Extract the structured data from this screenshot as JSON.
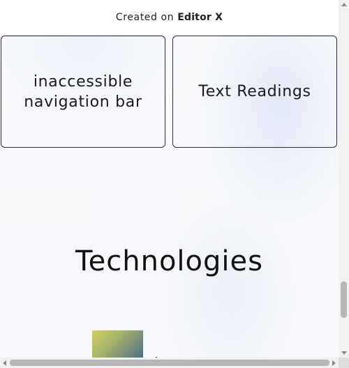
{
  "banner": {
    "prefix": "Created on",
    "brand": "Editor X"
  },
  "cards": [
    {
      "label": "inaccessible navigation bar"
    },
    {
      "label": "Text Readings"
    }
  ],
  "section": {
    "heading": "Technologies"
  },
  "colors": {
    "page_background": "#f7f9fc",
    "card_border": "#2a2a33",
    "text": "#111111"
  }
}
